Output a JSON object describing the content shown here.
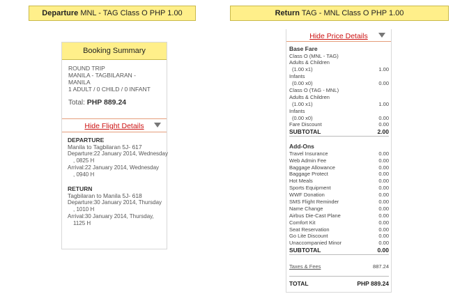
{
  "departure_banner": {
    "label": "Departure",
    "route": "MNL - TAG",
    "class": "Class O",
    "currency": "PHP",
    "amount": "1.00"
  },
  "return_banner": {
    "label": "Return",
    "route": "TAG - MNL",
    "class": "Class O",
    "currency": "PHP",
    "amount": "1.00"
  },
  "summary": {
    "title": "Booking Summary",
    "trip_type": "ROUND TRIP",
    "route_line1": "MANILA - TAGBILARAN -",
    "route_line2": "MANILA",
    "pax": "1 ADULT / 0 CHILD / 0 INFANT",
    "total_label": "Total:",
    "total_value": "PHP 889.24",
    "hide_flight_link": "Hide Flight Details"
  },
  "flights": {
    "departure": {
      "heading": "DEPARTURE",
      "route": "Manila to Tagbilaran 5J- 617",
      "dep_line": "Departure:22 January 2014, Wednesday",
      "dep_time": ", 0825 H",
      "arr_line": "Arrival:22 January 2014, Wednesday",
      "arr_time": ", 0940 H"
    },
    "return": {
      "heading": "RETURN",
      "route": "Tagbilaran to Manila 5J- 618",
      "dep_line": "Departure:30 January 2014, Thursday",
      "dep_time": ", 1010 H",
      "arr_line": "Arrival:30 January 2014, Thursday,",
      "arr_time": "1125 H"
    }
  },
  "price": {
    "hide_price_link": "Hide Price Details",
    "base_fare_heading": "Base Fare",
    "base_lines": [
      {
        "label": "Class O (MNL - TAG)",
        "value": ""
      },
      {
        "label": "Adults & Children",
        "value": ""
      },
      {
        "label": "(1.00 x1)",
        "value": "1.00",
        "indent": true
      },
      {
        "label": "Infants",
        "value": ""
      },
      {
        "label": "(0.00 x0)",
        "value": "0.00",
        "indent": true
      },
      {
        "label": "Class O (TAG - MNL)",
        "value": ""
      },
      {
        "label": "Adults & Children",
        "value": ""
      },
      {
        "label": "(1.00 x1)",
        "value": "1.00",
        "indent": true
      },
      {
        "label": "Infants",
        "value": ""
      },
      {
        "label": "(0.00 x0)",
        "value": "0.00",
        "indent": true
      },
      {
        "label": "Fare Discount",
        "value": "0.00"
      }
    ],
    "base_subtotal": {
      "label": "SUBTOTAL",
      "value": "2.00"
    },
    "addons_heading": "Add-Ons",
    "addon_lines": [
      {
        "label": "Travel Insurance",
        "value": "0.00"
      },
      {
        "label": "Web Admin Fee",
        "value": "0.00"
      },
      {
        "label": "Baggage Allowance",
        "value": "0.00"
      },
      {
        "label": "Baggage Protect",
        "value": "0.00"
      },
      {
        "label": "Hot Meals",
        "value": "0.00"
      },
      {
        "label": "Sports Equipment",
        "value": "0.00"
      },
      {
        "label": "WWF Donation",
        "value": "0.00"
      },
      {
        "label": "SMS Flight Reminder",
        "value": "0.00"
      },
      {
        "label": "Name Change",
        "value": "0.00"
      },
      {
        "label": "Airbus Die-Cast Plane",
        "value": "0.00"
      },
      {
        "label": "Comfort Kit",
        "value": "0.00"
      },
      {
        "label": "Seat Reservation",
        "value": "0.00"
      },
      {
        "label": "Go Lite Discount",
        "value": "0.00"
      },
      {
        "label": "Unaccompanied Minor",
        "value": "0.00"
      }
    ],
    "addons_subtotal": {
      "label": "SUBTOTAL",
      "value": "0.00"
    },
    "taxes_label": "Taxes & Fees",
    "taxes_value": "887.24",
    "total_label": "TOTAL",
    "total_value": "PHP 889.24"
  }
}
